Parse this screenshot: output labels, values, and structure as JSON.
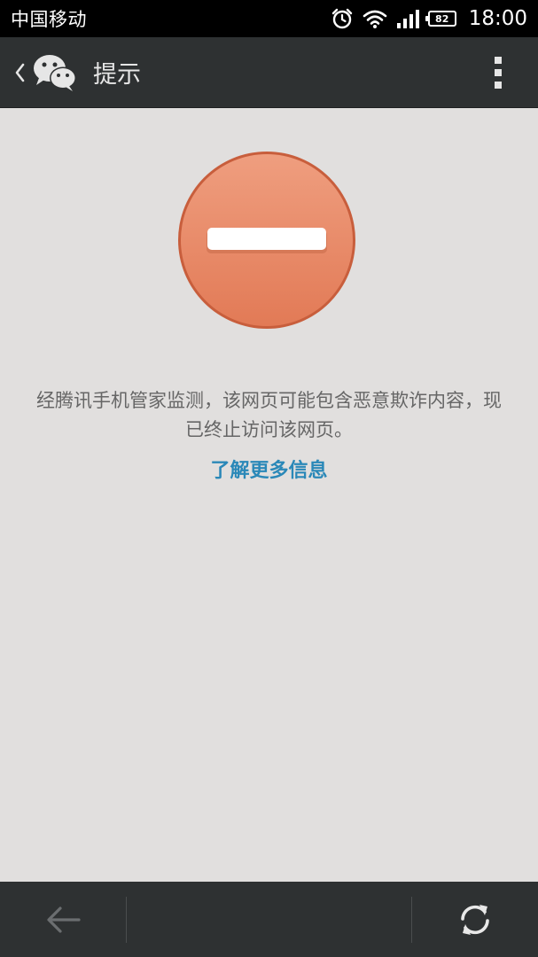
{
  "status_bar": {
    "carrier": "中国移动",
    "battery_level": "82",
    "time": "18:00",
    "icons": [
      "alarm-icon",
      "wifi-icon",
      "signal-icon",
      "battery-icon"
    ]
  },
  "title_bar": {
    "title": "提示",
    "icons": [
      "back-chevron-icon",
      "wechat-logo-icon",
      "more-menu-icon"
    ]
  },
  "main": {
    "block_icon": "blocked-icon",
    "message": "经腾讯手机管家监测，该网页可能包含恶意欺诈内容，现已终止访问该网页。",
    "learn_more": "了解更多信息"
  },
  "bottom_bar": {
    "icons": [
      "back-arrow-icon",
      "refresh-icon"
    ]
  },
  "colors": {
    "status_bar_bg": "#000000",
    "toolbar_bg": "#2e3132",
    "page_bg": "#e1dfde",
    "block_icon_fill": "#e8805f",
    "link_color": "#2a88b8",
    "message_text": "#666666"
  }
}
